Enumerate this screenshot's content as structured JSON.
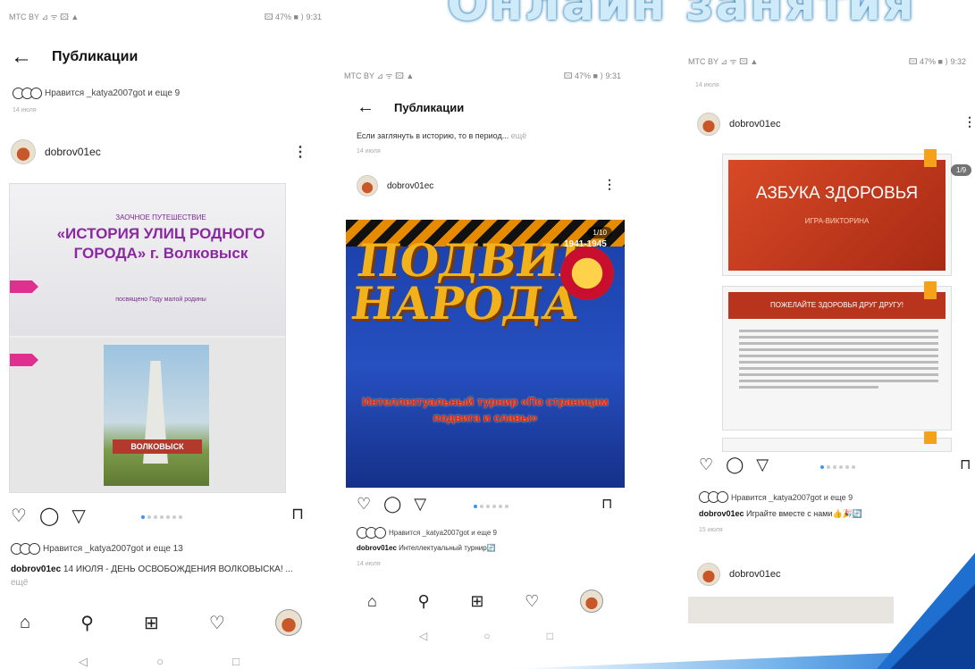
{
  "banner": {
    "title": "Онлайн занятия"
  },
  "phone1": {
    "status_left": "МТС BY ⊿ ᯤ 🖾 ▲",
    "status_right": "🖾 47% ■ ⟩ 9:31",
    "header_title": "Публикации",
    "top_likes_text": "Нравится _katya2007got и еще 9",
    "top_time": "14 июля",
    "username": "dobrov01ec",
    "slide": {
      "kicker": "ЗАОЧНОЕ ПУТЕШЕСТВИЕ",
      "title": "«ИСТОРИЯ УЛИЦ РОДНОГО ГОРОДА» г. Волковыск",
      "sub": "посвящено Году малой родины",
      "sign": "ВОЛКОВЫСК"
    },
    "likes_text": "Нравится _katya2007got и еще 13",
    "caption_user": "dobrov01ec",
    "caption_text": "14 ИЮЛЯ - ДЕНЬ ОСВОБОЖДЕНИЯ ВОЛКОВЫСКА! ...",
    "caption_more": "ещё",
    "sysnav": {
      "back": "◁",
      "home": "○",
      "recent": "□"
    }
  },
  "phone2": {
    "status_left": "МТС BY ⊿ ᯤ 🖾 ▲",
    "status_right": "🖾 47% ■ ⟩ 9:31",
    "header_title": "Публикации",
    "top_caption": "Если заглянуть в историю, то в период...",
    "top_more": "ещё",
    "top_time": "14 июля",
    "username": "dobrov01ec",
    "counter": "1/10",
    "slide": {
      "headline": "ПОДВИГ НАРОДА",
      "years": "1941-1945",
      "tournament": "Интеллектуальный турнир «По страницам подвига и славы»"
    },
    "likes_text": "Нравится _katya2007got и еще 9",
    "caption_user": "dobrov01ec",
    "caption_text": "Интеллектуальный турнир🔄",
    "caption_time": "14 июля",
    "sysnav": {
      "back": "◁",
      "home": "○",
      "recent": "□"
    }
  },
  "phone3": {
    "status_left": "МТС BY ⊿ ᯤ 🖾 ▲",
    "status_right": "🖾 47% ■ ⟩ 9:32",
    "top_time": "14 июля",
    "username": "dobrov01ec",
    "counter": "1/9",
    "slide1": {
      "title": "АЗБУКА ЗДОРОВЬЯ",
      "sub": "ИГРА-ВИКТОРИНА"
    },
    "slide2": {
      "title": "ПОЖЕЛАЙТЕ ЗДОРОВЬЯ ДРУГ ДРУГУ!"
    },
    "likes_text": "Нравится _katya2007got и еще 9",
    "caption_user": "dobrov01ec",
    "caption_text": "Играйте вместе с нами👍🎉🔄",
    "caption_time": "15 июля",
    "username2": "dobrov01ec"
  },
  "icons": {
    "heart": "♡",
    "comment": "◯",
    "share": "▽",
    "bookmark": "⊓",
    "home": "⌂",
    "search": "⚲",
    "add": "⊞",
    "more": "⋮",
    "back": "←"
  },
  "colors": {
    "banner": "#cfeaf8",
    "accent_blue": "#3897f0",
    "purple_title": "#8b27a0",
    "red_slide": "#b8341c"
  }
}
